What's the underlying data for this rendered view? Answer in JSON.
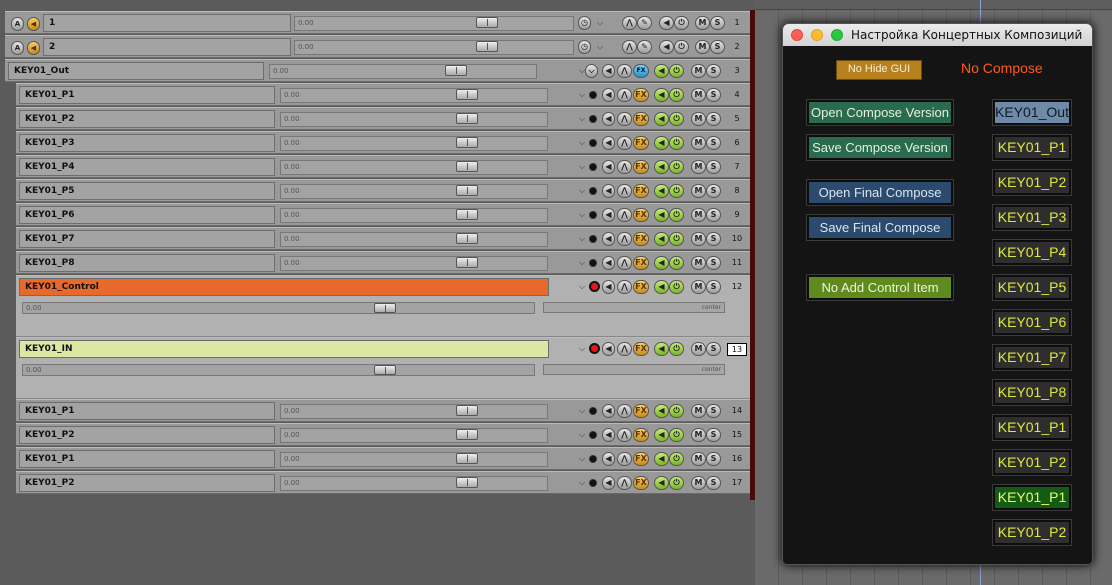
{
  "tracks": [
    {
      "name": "1",
      "num": "1",
      "vol": "0.00",
      "type": "folder"
    },
    {
      "name": "2",
      "num": "2",
      "vol": "0.00",
      "type": "folder"
    },
    {
      "name": "KEY01_Out",
      "num": "3",
      "vol": "0.00",
      "type": "out"
    },
    {
      "name": "KEY01_P1",
      "num": "4",
      "vol": "0.00",
      "type": "child"
    },
    {
      "name": "KEY01_P2",
      "num": "5",
      "vol": "0.00",
      "type": "child"
    },
    {
      "name": "KEY01_P3",
      "num": "6",
      "vol": "0.00",
      "type": "child"
    },
    {
      "name": "KEY01_P4",
      "num": "7",
      "vol": "0.00",
      "type": "child"
    },
    {
      "name": "KEY01_P5",
      "num": "8",
      "vol": "0.00",
      "type": "child"
    },
    {
      "name": "KEY01_P6",
      "num": "9",
      "vol": "0.00",
      "type": "child"
    },
    {
      "name": "KEY01_P7",
      "num": "10",
      "vol": "0.00",
      "type": "child"
    },
    {
      "name": "KEY01_P8",
      "num": "11",
      "vol": "0.00",
      "type": "child"
    },
    {
      "name": "KEY01_Control",
      "num": "12",
      "vol": "0.00",
      "type": "big",
      "name_color": "#e8692c",
      "pan": "center"
    },
    {
      "name": "KEY01_IN",
      "num": "13",
      "vol": "0.00",
      "type": "big",
      "name_color": "#dbe8a3",
      "pan": "center"
    },
    {
      "name": "KEY01_P1",
      "num": "14",
      "vol": "0.00",
      "type": "child"
    },
    {
      "name": "KEY01_P2",
      "num": "15",
      "vol": "0.00",
      "type": "child"
    },
    {
      "name": "KEY01_P1",
      "num": "16",
      "vol": "0.00",
      "type": "child"
    },
    {
      "name": "KEY01_P2",
      "num": "17",
      "vol": "0.00",
      "type": "child"
    }
  ],
  "button_glyphs": {
    "mute": "M",
    "solo": "S",
    "fx": "FX"
  },
  "dialog": {
    "title": "Настройка Концертных Композиций",
    "no_hide_gui": "No Hide GUI",
    "no_compose": "No Compose",
    "open_compose_version": "Open Compose Version",
    "save_compose_version": "Save Compose Version",
    "open_final_compose": "Open Final Compose",
    "save_final_compose": "Save Final Compose",
    "no_add_control_item": "No Add Control Item",
    "track_buttons": [
      "KEY01_Out",
      "KEY01_P1",
      "KEY01_P2",
      "KEY01_P3",
      "KEY01_P4",
      "KEY01_P5",
      "KEY01_P6",
      "KEY01_P7",
      "KEY01_P8",
      "KEY01_P1",
      "KEY01_P2",
      "KEY01_P1",
      "KEY01_P2"
    ]
  },
  "colors": {
    "compose_green": "#2a6b50",
    "final_blue": "#2b4a6e",
    "control_green": "#5f8a1e",
    "no_compose_text": "#ff5a1f",
    "track_text": "#dde83c",
    "selected": "#6e8aa8",
    "active": "#145c14"
  }
}
